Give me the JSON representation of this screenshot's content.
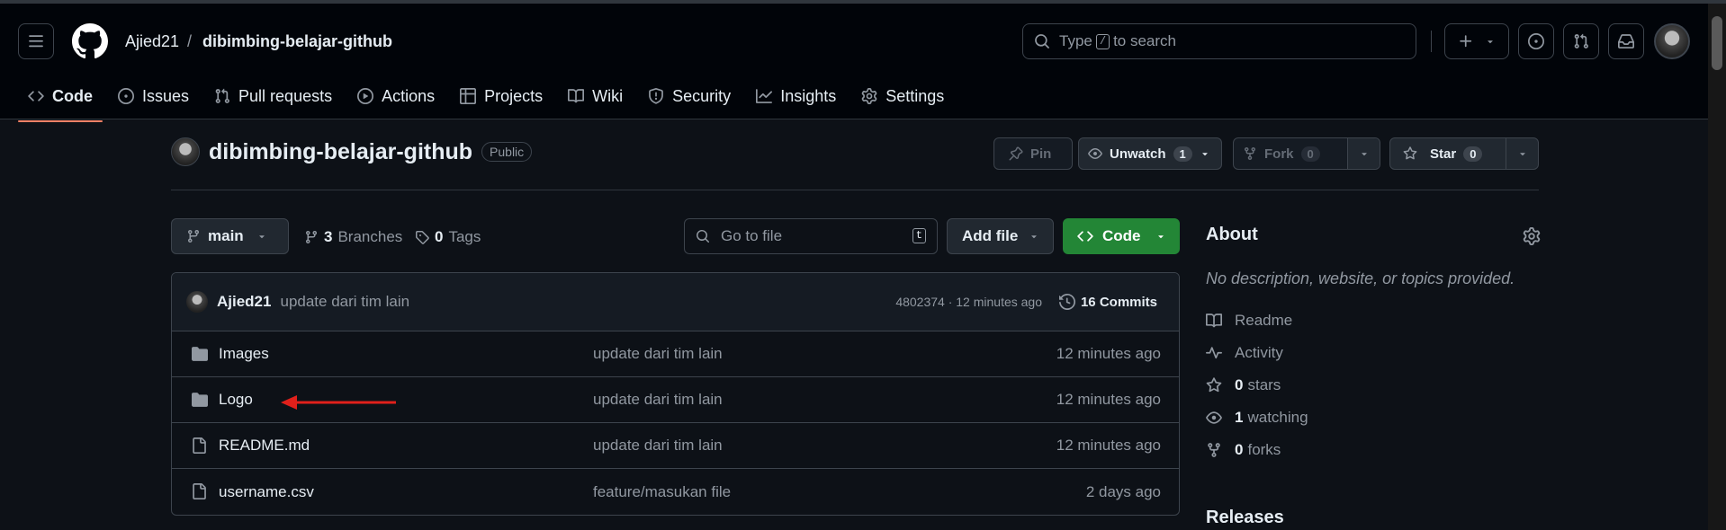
{
  "header": {
    "owner": "Ajied21",
    "separator": "/",
    "repo": "dibimbing-belajar-github",
    "search": {
      "pre": "Type",
      "key": "/",
      "post": "to search"
    }
  },
  "tabs": [
    {
      "label": "Code",
      "icon": "code-icon",
      "active": true
    },
    {
      "label": "Issues",
      "icon": "issue-icon"
    },
    {
      "label": "Pull requests",
      "icon": "pull-request-icon"
    },
    {
      "label": "Actions",
      "icon": "play-icon"
    },
    {
      "label": "Projects",
      "icon": "table-icon"
    },
    {
      "label": "Wiki",
      "icon": "book-icon"
    },
    {
      "label": "Security",
      "icon": "shield-icon"
    },
    {
      "label": "Insights",
      "icon": "graph-icon"
    },
    {
      "label": "Settings",
      "icon": "gear-icon"
    }
  ],
  "repo": {
    "name": "dibimbing-belajar-github",
    "visibility": "Public",
    "pin_label": "Pin",
    "unwatch_label": "Unwatch",
    "unwatch_count": "1",
    "fork_label": "Fork",
    "fork_count": "0",
    "star_label": "Star",
    "star_count": "0"
  },
  "toolbar": {
    "branch": "main",
    "branches_count": "3",
    "branches_label": "Branches",
    "tags_count": "0",
    "tags_label": "Tags",
    "goto_placeholder": "Go to file",
    "goto_key": "t",
    "add_file": "Add file",
    "code": "Code"
  },
  "commit": {
    "author": "Ajied21",
    "message": "update dari tim lain",
    "hash_time": "4802374 · 12 minutes ago",
    "commits_label": "16 Commits"
  },
  "files": [
    {
      "type": "folder",
      "name": "Images",
      "message": "update dari tim lain",
      "date": "12 minutes ago"
    },
    {
      "type": "folder",
      "name": "Logo",
      "message": "update dari tim lain",
      "date": "12 minutes ago"
    },
    {
      "type": "file",
      "name": "README.md",
      "message": "update dari tim lain",
      "date": "12 minutes ago"
    },
    {
      "type": "file",
      "name": "username.csv",
      "message": "feature/masukan file",
      "date": "2 days ago"
    }
  ],
  "about": {
    "title": "About",
    "description": "No description, website, or topics provided.",
    "items": [
      {
        "icon": "book-icon",
        "value": "",
        "label": "Readme"
      },
      {
        "icon": "pulse-icon",
        "value": "",
        "label": "Activity"
      },
      {
        "icon": "star-icon",
        "value": "0",
        "label": "stars"
      },
      {
        "icon": "eye-icon",
        "value": "1",
        "label": "watching"
      },
      {
        "icon": "fork-icon",
        "value": "0",
        "label": "forks"
      }
    ]
  },
  "releases_title": "Releases",
  "colors": {
    "accent_tab": "#f78166",
    "code_button": "#238636",
    "annotation_arrow": "#e0201b"
  }
}
